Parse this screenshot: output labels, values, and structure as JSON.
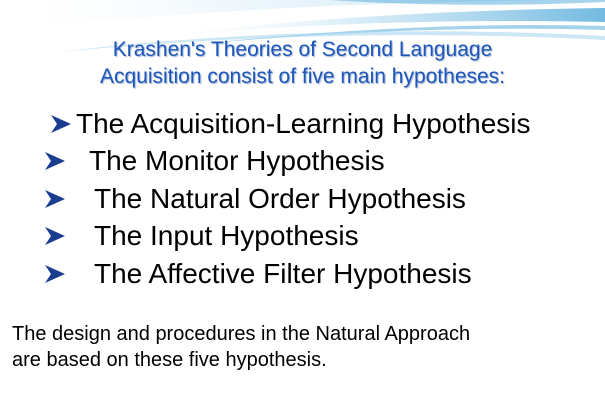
{
  "slide": {
    "title_line_1": "Krashen's Theories of Second Language",
    "title_line_2": "Acquisition consist of five main hypotheses:",
    "bullets": [
      "The Acquisition-Learning Hypothesis",
      "The Monitor Hypothesis",
      "The Natural Order Hypothesis",
      "The Input Hypothesis",
      "The Affective Filter Hypothesis"
    ],
    "footer_line_1": "The design and procedures in the Natural Approach",
    "footer_line_2": "are based on these five hypothesis."
  },
  "colors": {
    "title": "#1f57b8",
    "bullet_arrow": "#1a3d8f",
    "body_text": "#000000",
    "background": "#ffffff"
  },
  "icons": {
    "bullet": "arrowhead-bullet-icon",
    "decoration": "wave-decoration"
  }
}
